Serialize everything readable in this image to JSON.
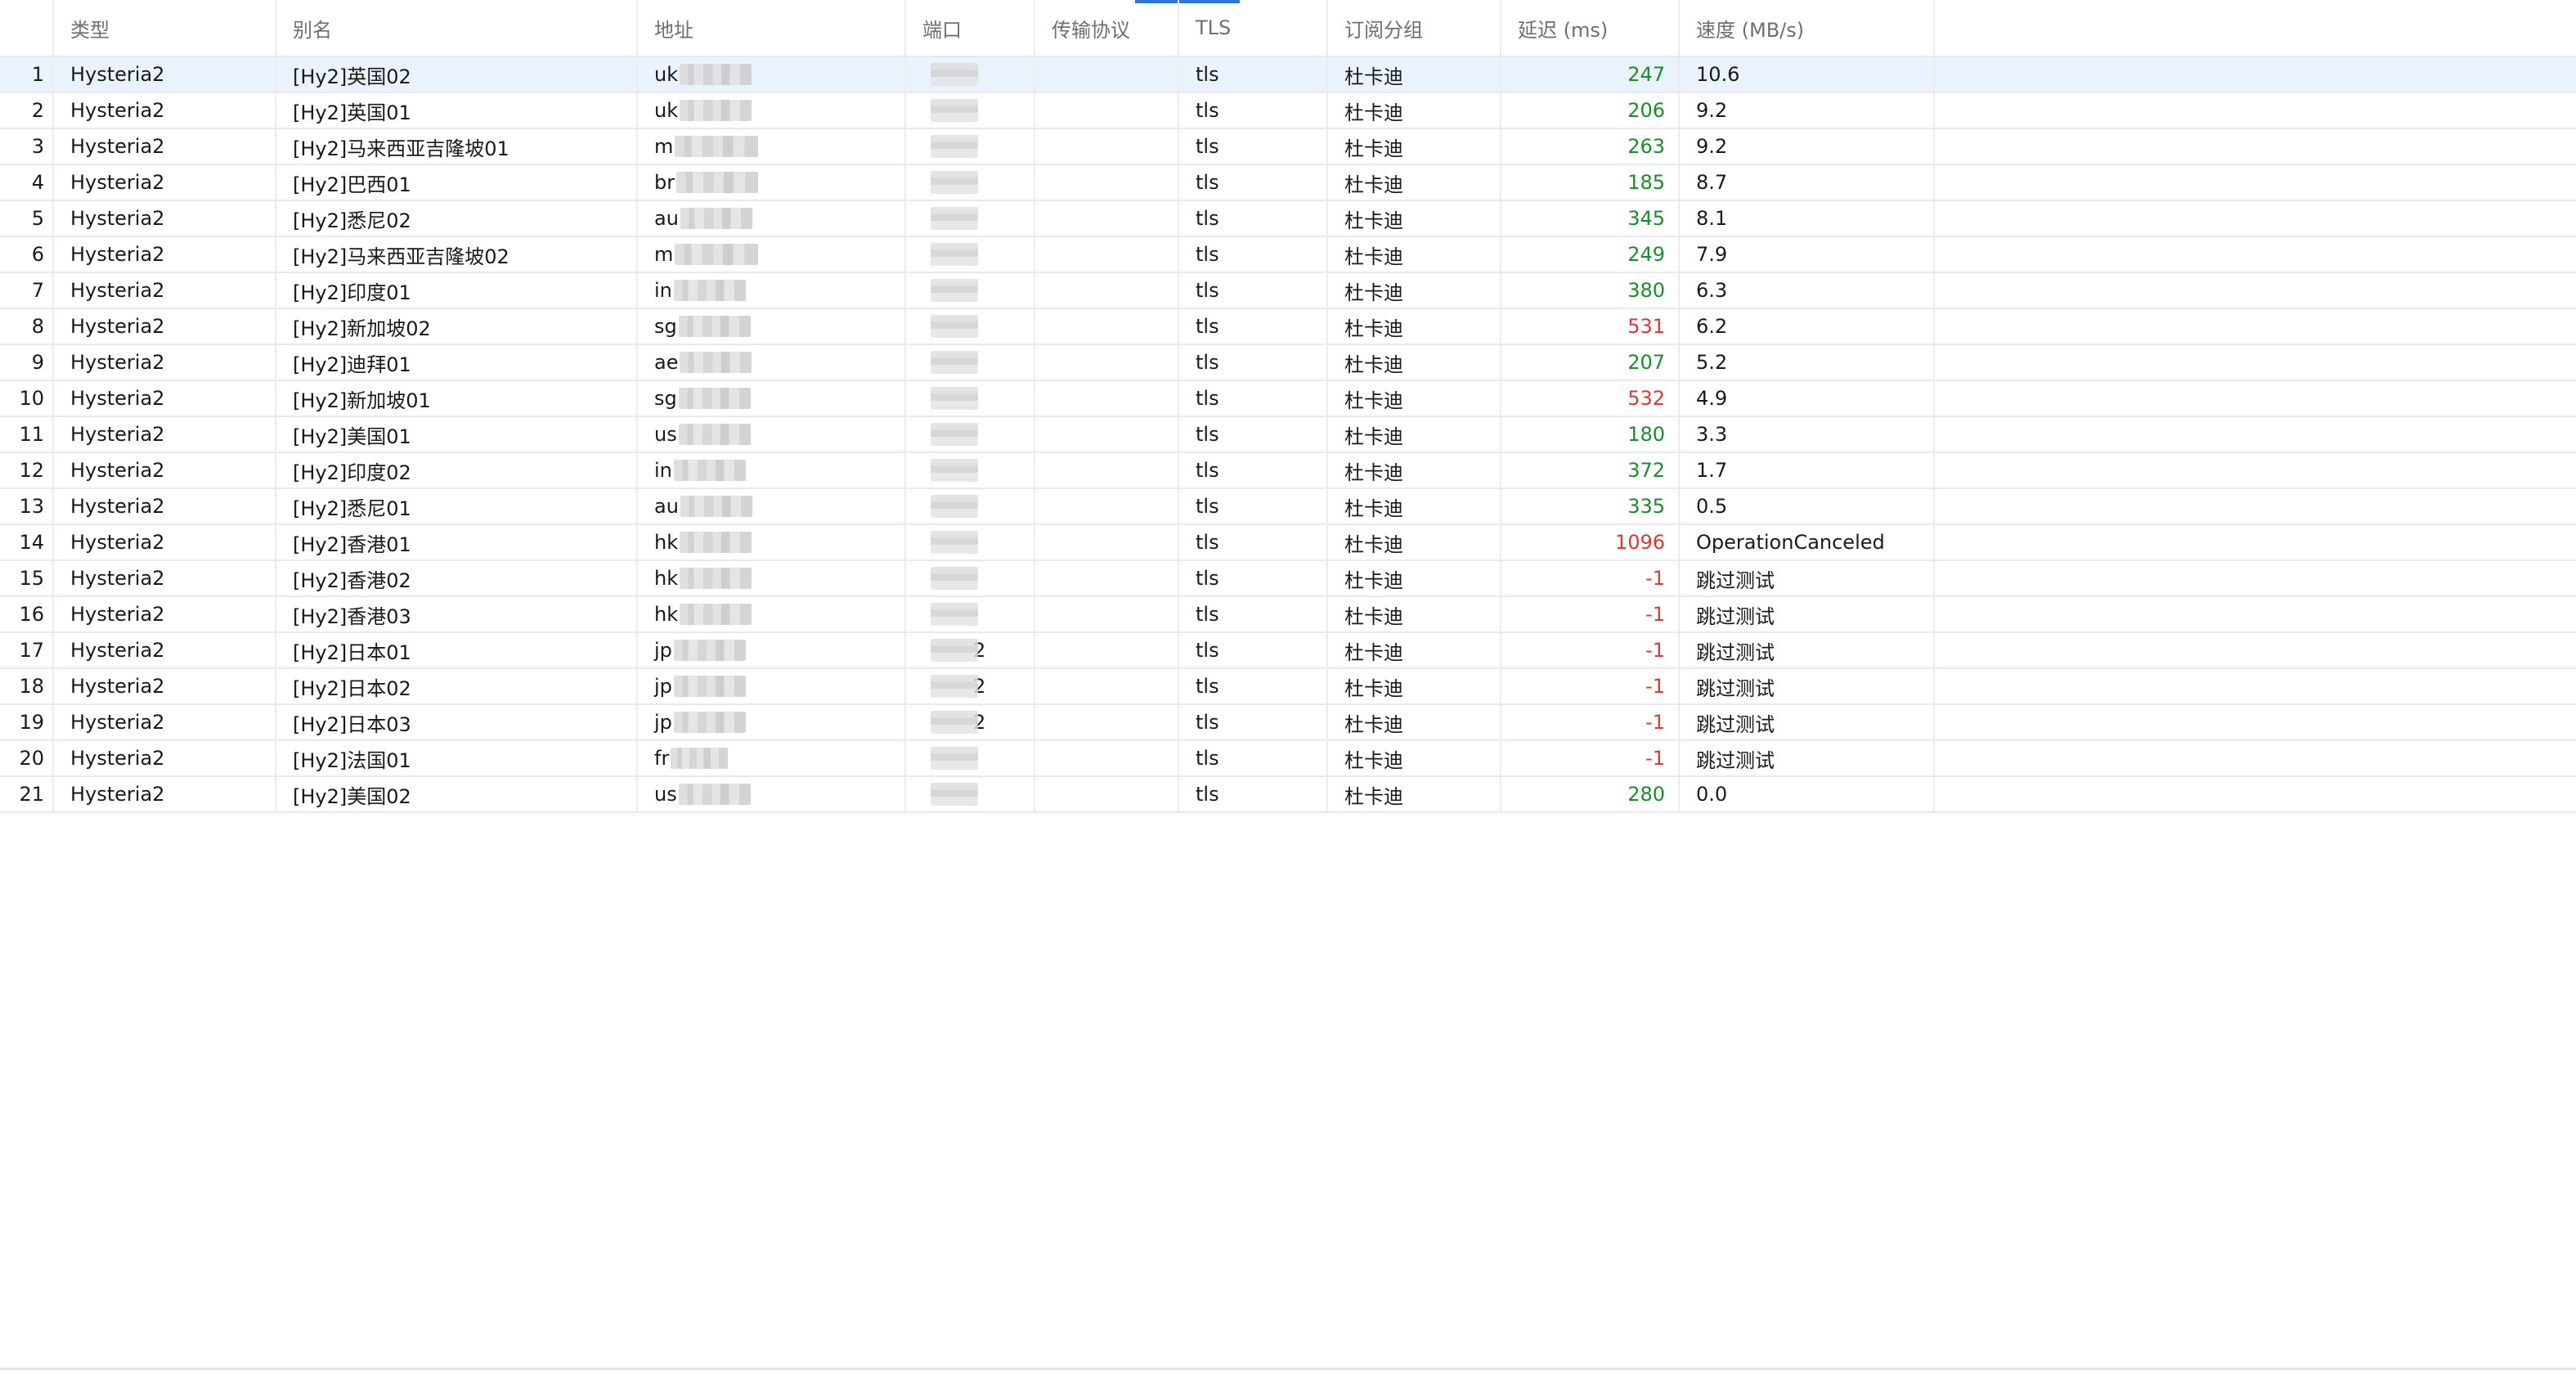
{
  "columns": {
    "type": "类型",
    "alias": "别名",
    "address": "地址",
    "port": "端口",
    "transport": "传输协议",
    "tls": "TLS",
    "group": "订阅分组",
    "delay": "延迟 (ms)",
    "speed": "速度 (MB/s)"
  },
  "colors": {
    "delay_ok": "#1e8a2e",
    "delay_bad": "#d23b3b",
    "selected_row": "#eaf3fd",
    "accent": "#2f74d0"
  },
  "rows": [
    {
      "index": "1",
      "type": "Hysteria2",
      "alias": "[Hy2]英国02",
      "addr_prefix": "uk",
      "port_suffix": "",
      "transport": "",
      "tls": "tls",
      "group": "杜卡迪",
      "delay": "247",
      "delay_status": "ok",
      "speed": "10.6",
      "selected": true
    },
    {
      "index": "2",
      "type": "Hysteria2",
      "alias": "[Hy2]英国01",
      "addr_prefix": "uk",
      "port_suffix": "",
      "transport": "",
      "tls": "tls",
      "group": "杜卡迪",
      "delay": "206",
      "delay_status": "ok",
      "speed": "9.2"
    },
    {
      "index": "3",
      "type": "Hysteria2",
      "alias": "[Hy2]马来西亚吉隆坡01",
      "addr_prefix": "m",
      "port_suffix": "",
      "transport": "",
      "tls": "tls",
      "group": "杜卡迪",
      "delay": "263",
      "delay_status": "ok",
      "speed": "9.2"
    },
    {
      "index": "4",
      "type": "Hysteria2",
      "alias": "[Hy2]巴西01",
      "addr_prefix": "br",
      "port_suffix": "",
      "transport": "",
      "tls": "tls",
      "group": "杜卡迪",
      "delay": "185",
      "delay_status": "ok",
      "speed": "8.7"
    },
    {
      "index": "5",
      "type": "Hysteria2",
      "alias": "[Hy2]悉尼02",
      "addr_prefix": "au",
      "port_suffix": "",
      "transport": "",
      "tls": "tls",
      "group": "杜卡迪",
      "delay": "345",
      "delay_status": "ok",
      "speed": "8.1"
    },
    {
      "index": "6",
      "type": "Hysteria2",
      "alias": "[Hy2]马来西亚吉隆坡02",
      "addr_prefix": "m",
      "port_suffix": "",
      "transport": "",
      "tls": "tls",
      "group": "杜卡迪",
      "delay": "249",
      "delay_status": "ok",
      "speed": "7.9"
    },
    {
      "index": "7",
      "type": "Hysteria2",
      "alias": "[Hy2]印度01",
      "addr_prefix": "in",
      "port_suffix": "",
      "transport": "",
      "tls": "tls",
      "group": "杜卡迪",
      "delay": "380",
      "delay_status": "ok",
      "speed": "6.3"
    },
    {
      "index": "8",
      "type": "Hysteria2",
      "alias": "[Hy2]新加坡02",
      "addr_prefix": "sg",
      "port_suffix": "",
      "transport": "",
      "tls": "tls",
      "group": "杜卡迪",
      "delay": "531",
      "delay_status": "bad",
      "speed": "6.2"
    },
    {
      "index": "9",
      "type": "Hysteria2",
      "alias": "[Hy2]迪拜01",
      "addr_prefix": "ae",
      "port_suffix": "",
      "transport": "",
      "tls": "tls",
      "group": "杜卡迪",
      "delay": "207",
      "delay_status": "ok",
      "speed": "5.2"
    },
    {
      "index": "10",
      "type": "Hysteria2",
      "alias": "[Hy2]新加坡01",
      "addr_prefix": "sg",
      "port_suffix": "",
      "transport": "",
      "tls": "tls",
      "group": "杜卡迪",
      "delay": "532",
      "delay_status": "bad",
      "speed": "4.9"
    },
    {
      "index": "11",
      "type": "Hysteria2",
      "alias": "[Hy2]美国01",
      "addr_prefix": "us",
      "port_suffix": "",
      "transport": "",
      "tls": "tls",
      "group": "杜卡迪",
      "delay": "180",
      "delay_status": "ok",
      "speed": "3.3"
    },
    {
      "index": "12",
      "type": "Hysteria2",
      "alias": "[Hy2]印度02",
      "addr_prefix": "in",
      "port_suffix": "",
      "transport": "",
      "tls": "tls",
      "group": "杜卡迪",
      "delay": "372",
      "delay_status": "ok",
      "speed": "1.7"
    },
    {
      "index": "13",
      "type": "Hysteria2",
      "alias": "[Hy2]悉尼01",
      "addr_prefix": "au",
      "port_suffix": "",
      "transport": "",
      "tls": "tls",
      "group": "杜卡迪",
      "delay": "335",
      "delay_status": "ok",
      "speed": "0.5"
    },
    {
      "index": "14",
      "type": "Hysteria2",
      "alias": "[Hy2]香港01",
      "addr_prefix": "hk",
      "port_suffix": "",
      "transport": "",
      "tls": "tls",
      "group": "杜卡迪",
      "delay": "1096",
      "delay_status": "bad",
      "speed": "OperationCanceled"
    },
    {
      "index": "15",
      "type": "Hysteria2",
      "alias": "[Hy2]香港02",
      "addr_prefix": "hk",
      "port_suffix": "",
      "transport": "",
      "tls": "tls",
      "group": "杜卡迪",
      "delay": "-1",
      "delay_status": "bad",
      "speed": "跳过测试"
    },
    {
      "index": "16",
      "type": "Hysteria2",
      "alias": "[Hy2]香港03",
      "addr_prefix": "hk",
      "port_suffix": "",
      "transport": "",
      "tls": "tls",
      "group": "杜卡迪",
      "delay": "-1",
      "delay_status": "bad",
      "speed": "跳过测试"
    },
    {
      "index": "17",
      "type": "Hysteria2",
      "alias": "[Hy2]日本01",
      "addr_prefix": "jp",
      "port_suffix": "2",
      "transport": "",
      "tls": "tls",
      "group": "杜卡迪",
      "delay": "-1",
      "delay_status": "bad",
      "speed": "跳过测试"
    },
    {
      "index": "18",
      "type": "Hysteria2",
      "alias": "[Hy2]日本02",
      "addr_prefix": "jp",
      "port_suffix": "2",
      "transport": "",
      "tls": "tls",
      "group": "杜卡迪",
      "delay": "-1",
      "delay_status": "bad",
      "speed": "跳过测试"
    },
    {
      "index": "19",
      "type": "Hysteria2",
      "alias": "[Hy2]日本03",
      "addr_prefix": "jp",
      "port_suffix": "2",
      "transport": "",
      "tls": "tls",
      "group": "杜卡迪",
      "delay": "-1",
      "delay_status": "bad",
      "speed": "跳过测试"
    },
    {
      "index": "20",
      "type": "Hysteria2",
      "alias": "[Hy2]法国01",
      "addr_prefix": "fr",
      "port_suffix": "",
      "transport": "",
      "tls": "tls",
      "group": "杜卡迪",
      "delay": "-1",
      "delay_status": "bad",
      "speed": "跳过测试"
    },
    {
      "index": "21",
      "type": "Hysteria2",
      "alias": "[Hy2]美国02",
      "addr_prefix": "us",
      "port_suffix": "",
      "transport": "",
      "tls": "tls",
      "group": "杜卡迪",
      "delay": "280",
      "delay_status": "ok",
      "speed": "0.0"
    }
  ]
}
